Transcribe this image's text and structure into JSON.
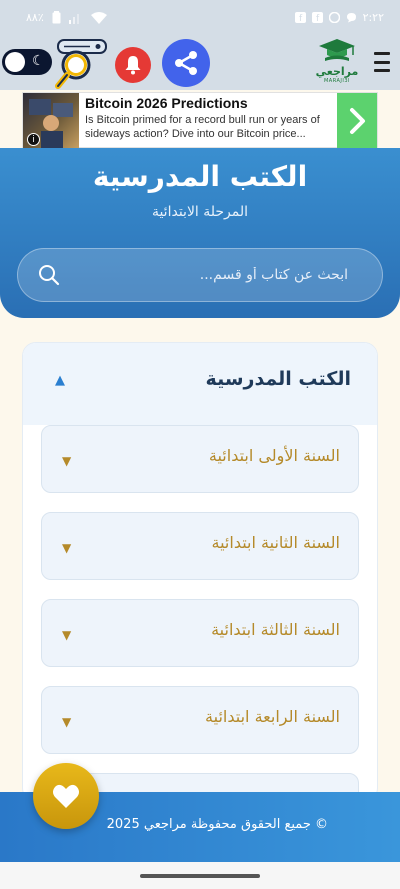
{
  "status_bar": {
    "time": "٢:٢٢",
    "battery": "٨٨٪",
    "notification_icons": [
      "facebook-icon",
      "facebook-icon",
      "whatsapp-icon",
      "messenger-icon"
    ]
  },
  "header": {
    "brand_name": "مراجعي",
    "brand_tagline": "MARAJI3I",
    "icons": [
      "moon-icon",
      "search-icon",
      "bell-icon",
      "share-icon",
      "menu-icon"
    ]
  },
  "ad": {
    "title": "Bitcoin 2026 Predictions",
    "description": "Is Bitcoin primed for a record bull run or years of sideways action? Dive into our Bitcoin price...",
    "info_icon": "i"
  },
  "hero": {
    "title": "الكتب المدرسية",
    "subtitle": "المرحلة الابتدائية",
    "search_placeholder": "ابحث عن كتاب أو قسم..."
  },
  "section": {
    "title": "الكتب المدرسية",
    "expanded": true,
    "years": [
      {
        "label": "السنة الأولى ابتدائية"
      },
      {
        "label": "السنة الثانية ابتدائية"
      },
      {
        "label": "السنة الثالثة ابتدائية"
      },
      {
        "label": "السنة الرابعة ابتدائية"
      },
      {
        "label": ""
      }
    ]
  },
  "footer": {
    "copyright": "© جميع الحقوق محفوظة مراجعي 2025"
  },
  "colors": {
    "primary_blue": "#2a78c8",
    "gold": "#b58a2a",
    "fav_button": "#e0aa14",
    "share_button": "#4263eb",
    "bell_button": "#e53935"
  }
}
